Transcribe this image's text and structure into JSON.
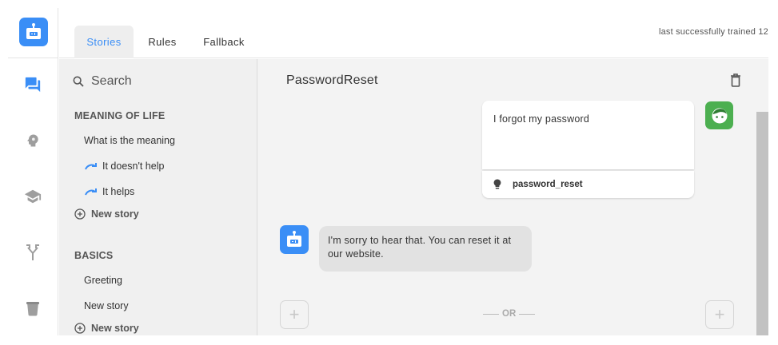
{
  "rail": {
    "logo_icon": "robot-icon",
    "items": [
      {
        "icon": "chat-bubbles-icon",
        "active": true
      },
      {
        "icon": "brain-lightbulb-icon",
        "active": false
      },
      {
        "icon": "graduation-cap-icon",
        "active": false
      },
      {
        "icon": "branch-fork-icon",
        "active": false
      },
      {
        "icon": "pail-icon",
        "active": false
      }
    ]
  },
  "tabs": [
    {
      "label": "Stories",
      "active": true
    },
    {
      "label": "Rules",
      "active": false
    },
    {
      "label": "Fallback",
      "active": false
    }
  ],
  "trained_status": "last successfully trained 12",
  "search": {
    "placeholder": "Search",
    "icon": "search-icon"
  },
  "groups": [
    {
      "title": "MEANING OF LIFE",
      "stories": [
        {
          "label": "What is the meaning",
          "branch": false
        },
        {
          "label": "It doesn't help",
          "branch": true
        },
        {
          "label": "It helps",
          "branch": true
        }
      ],
      "new_story_label": "New story"
    },
    {
      "title": "BASICS",
      "stories": [
        {
          "label": "Greeting",
          "branch": false
        },
        {
          "label": "New story",
          "branch": false
        }
      ],
      "new_story_label": "New story"
    }
  ],
  "story": {
    "title": "PasswordReset",
    "user_message": "I forgot my password",
    "intent": "password_reset",
    "bot_message": "I'm sorry to hear that. You can reset it at our website.",
    "or_label": "OR",
    "add_label": "+"
  },
  "colors": {
    "accent": "#3a8ef6",
    "user_avatar": "#4caf50",
    "list_bg": "#f0f0f0",
    "main_bg": "#f3f3f3"
  }
}
